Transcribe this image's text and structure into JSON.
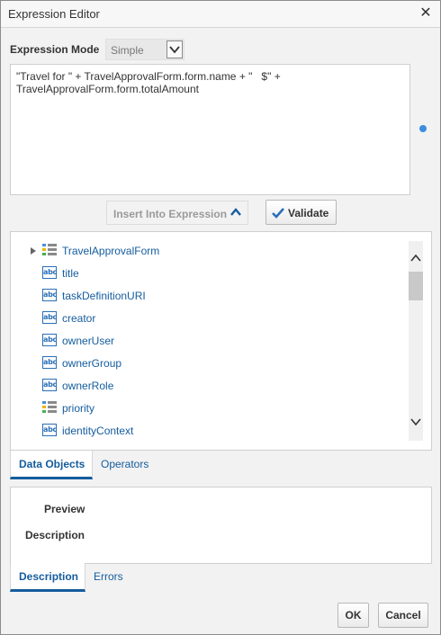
{
  "dialog": {
    "title": "Expression Editor",
    "close_icon": "close-icon"
  },
  "mode": {
    "label": "Expression Mode",
    "value": "Simple"
  },
  "expression": {
    "text": "\"Travel for \" + TravelApprovalForm.form.name + \"   $\" +\nTravelApprovalForm.form.totalAmount"
  },
  "buttons": {
    "insert": "Insert Into Expression",
    "validate": "Validate",
    "ok": "OK",
    "cancel": "Cancel"
  },
  "tree": {
    "items": [
      {
        "label": "TravelApprovalForm",
        "icon": "form-icon",
        "expandable": true
      },
      {
        "label": "title",
        "icon": "abc-icon",
        "expandable": false
      },
      {
        "label": "taskDefinitionURI",
        "icon": "abc-icon",
        "expandable": false
      },
      {
        "label": "creator",
        "icon": "abc-icon",
        "expandable": false
      },
      {
        "label": "ownerUser",
        "icon": "abc-icon",
        "expandable": false
      },
      {
        "label": "ownerGroup",
        "icon": "abc-icon",
        "expandable": false
      },
      {
        "label": "ownerRole",
        "icon": "abc-icon",
        "expandable": false
      },
      {
        "label": "priority",
        "icon": "form-icon",
        "expandable": false
      },
      {
        "label": "identityContext",
        "icon": "abc-icon",
        "expandable": false
      }
    ],
    "abc_text": "abc"
  },
  "tabs_top": [
    {
      "label": "Data Objects",
      "active": true
    },
    {
      "label": "Operators",
      "active": false
    }
  ],
  "preview": {
    "preview_label": "Preview",
    "description_label": "Description"
  },
  "tabs_bottom": [
    {
      "label": "Description",
      "active": true
    },
    {
      "label": "Errors",
      "active": false
    }
  ],
  "colors": {
    "link": "#145c9e",
    "accent_dot": "#3d8de0",
    "icon_blue": "#2a6fb7"
  }
}
